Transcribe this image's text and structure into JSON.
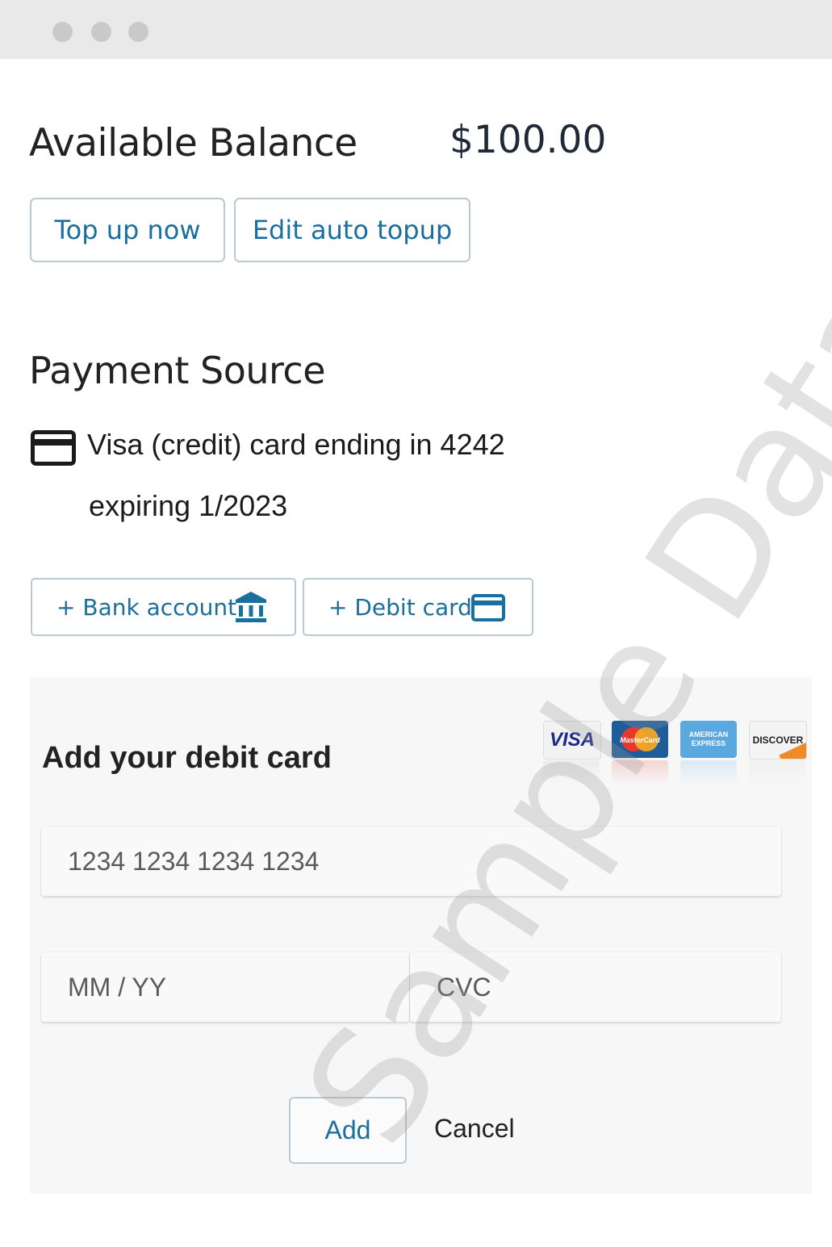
{
  "window": {
    "controls": [
      "close",
      "minimize",
      "maximize"
    ]
  },
  "balance": {
    "label": "Available Balance",
    "amount": "$100.00"
  },
  "actions": {
    "top_up": "Top up now",
    "edit_auto_topup": "Edit auto topup"
  },
  "payment_source": {
    "title": "Payment Source",
    "card_icon": "credit-card-icon",
    "card_line1": "Visa (credit) card ending in 4242",
    "card_line2": "expiring 1/2023",
    "add_bank_account": "+ Bank account",
    "add_debit_card": "+ Debit card"
  },
  "debit_form": {
    "title": "Add your debit card",
    "brands": [
      "VISA",
      "MasterCard",
      "AMERICAN EXPRESS",
      "DISCOVER"
    ],
    "card_number_placeholder": "1234 1234 1234 1234",
    "expiry_placeholder": "MM / YY",
    "cvc_placeholder": "CVC",
    "submit_label": "Add",
    "cancel_label": "Cancel"
  },
  "watermark": "Sample Data",
  "colors": {
    "accent": "#1a6f9c",
    "border": "#b9c9d6",
    "titlebar": "#e9e9e9"
  }
}
